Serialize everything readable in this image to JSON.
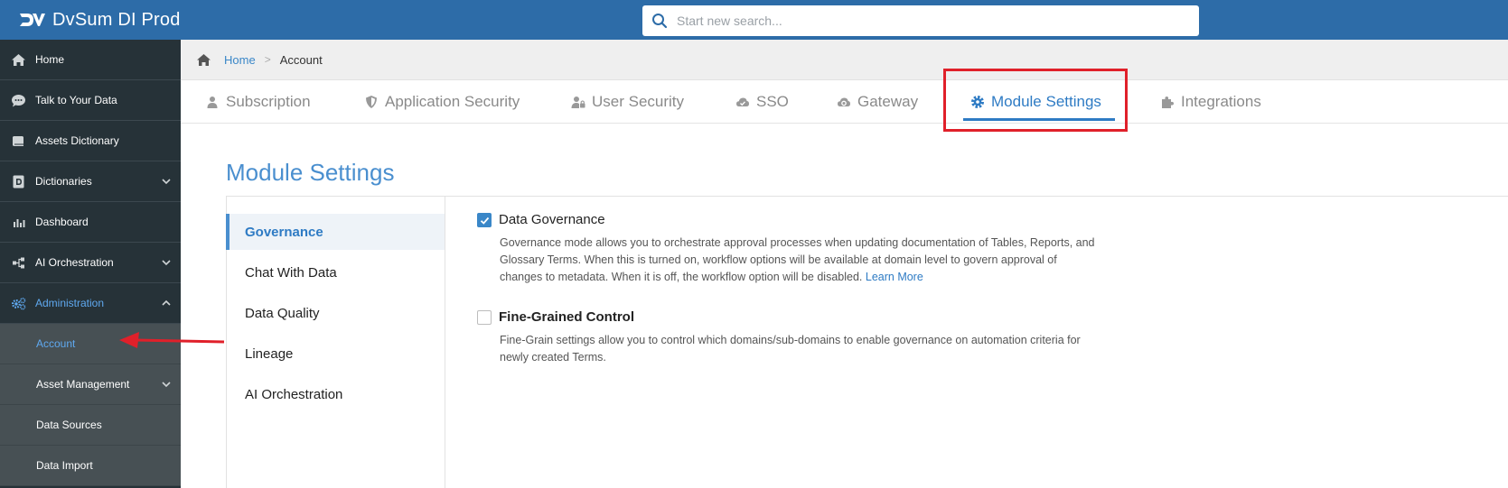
{
  "app": {
    "title": "DvSum DI Prod"
  },
  "search": {
    "placeholder": "Start new search..."
  },
  "sidebar": {
    "items": [
      {
        "label": "Home",
        "icon": "home-icon"
      },
      {
        "label": "Talk to Your Data",
        "icon": "chat-icon"
      },
      {
        "label": "Assets Dictionary",
        "icon": "book-icon"
      },
      {
        "label": "Dictionaries",
        "icon": "dictionary-icon",
        "expandable": true
      },
      {
        "label": "Dashboard",
        "icon": "bar-chart-icon"
      },
      {
        "label": "AI Orchestration",
        "icon": "flow-icon",
        "expandable": true
      },
      {
        "label": "Administration",
        "icon": "gears-icon",
        "expanded": true,
        "active": true
      }
    ],
    "subitems": [
      {
        "label": "Account",
        "current": true
      },
      {
        "label": "Asset Management",
        "expandable": true
      },
      {
        "label": "Data Sources"
      },
      {
        "label": "Data Import"
      }
    ]
  },
  "breadcrumb": {
    "home": "Home",
    "current": "Account",
    "separator": ">"
  },
  "tabs": [
    {
      "label": "Subscription",
      "icon": "user-icon"
    },
    {
      "label": "Application Security",
      "icon": "shield-icon"
    },
    {
      "label": "User Security",
      "icon": "user-lock-icon"
    },
    {
      "label": "SSO",
      "icon": "cloud-check-icon"
    },
    {
      "label": "Gateway",
      "icon": "cloud-upload-icon"
    },
    {
      "label": "Module Settings",
      "icon": "gear-icon",
      "active": true
    },
    {
      "label": "Integrations",
      "icon": "puzzle-icon"
    }
  ],
  "main": {
    "title": "Module Settings",
    "menu": [
      "Governance",
      "Chat With Data",
      "Data Quality",
      "Lineage",
      "AI Orchestration"
    ],
    "settings": [
      {
        "title": "Data Governance",
        "checked": true,
        "description": "Governance mode allows you to orchestrate approval processes when updating documentation of Tables, Reports, and Glossary Terms. When this is turned on, workflow options will be available at domain level to govern approval of changes to metadata. When it is off, the workflow option will be disabled.",
        "link": "Learn More"
      },
      {
        "title": "Fine-Grained Control",
        "checked": false,
        "description": "Fine-Grain settings allow you to control which domains/sub-domains to enable governance on automation criteria for newly created Terms."
      }
    ]
  },
  "colors": {
    "topbar": "#2d6ca8",
    "sidebar": "#263238",
    "accent": "#2e7bc4",
    "highlight": "#e0202a"
  }
}
